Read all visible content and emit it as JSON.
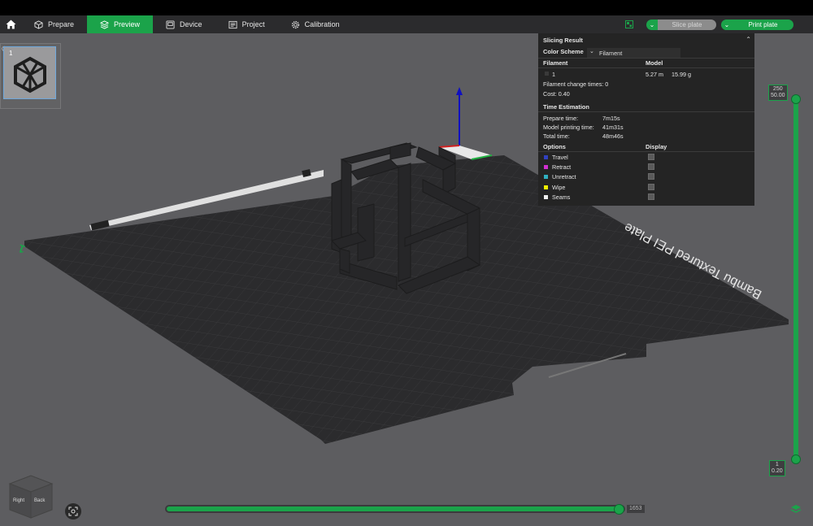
{
  "menubar": {
    "tabs": [
      {
        "label": "Prepare",
        "icon": "cube-outline-icon",
        "active": false
      },
      {
        "label": "Preview",
        "icon": "layers-icon",
        "active": true
      },
      {
        "label": "Device",
        "icon": "device-icon",
        "active": false
      },
      {
        "label": "Project",
        "icon": "project-icon",
        "active": false
      },
      {
        "label": "Calibration",
        "icon": "gear-icon",
        "active": false
      }
    ],
    "slice_label": "Slice plate",
    "print_label": "Print plate"
  },
  "plates": {
    "selected_number": "1"
  },
  "plate_text": "Bambu Textured PEI Plate",
  "plate_number_label": "1",
  "slicing_result": {
    "title": "Slicing Result",
    "color_scheme_label": "Color Scheme",
    "color_scheme_value": "Filament",
    "filament_header": "Filament",
    "model_header": "Model",
    "filament_id": "1",
    "model_length": "5.27 m",
    "model_weight": "15.99 g",
    "filament_change_times": "Filament change times:  0",
    "cost": "Cost:  0.40",
    "time_estimation_header": "Time Estimation",
    "prepare_time_label": "Prepare time:",
    "prepare_time_value": "7m15s",
    "model_printing_time_label": "Model printing time:",
    "model_printing_time_value": "41m31s",
    "total_time_label": "Total time:",
    "total_time_value": "48m46s",
    "options_header": "Options",
    "display_header": "Display",
    "options": [
      {
        "label": "Travel",
        "color": "#3040c0"
      },
      {
        "label": "Retract",
        "color": "#d030d0"
      },
      {
        "label": "Unretract",
        "color": "#30b0c0"
      },
      {
        "label": "Wipe",
        "color": "#f0f000"
      },
      {
        "label": "Seams",
        "color": "#f0f0f0"
      }
    ]
  },
  "layer_slider": {
    "top_layer": "250",
    "top_height": "50.00",
    "bottom_layer": "1",
    "bottom_height": "0.20"
  },
  "move_slider": {
    "value": "1653"
  },
  "view_cube": {
    "right": "Right",
    "back": "Back"
  },
  "colors": {
    "accent": "#1ba34a",
    "background": "#5d5d60",
    "panel": "#242424"
  }
}
